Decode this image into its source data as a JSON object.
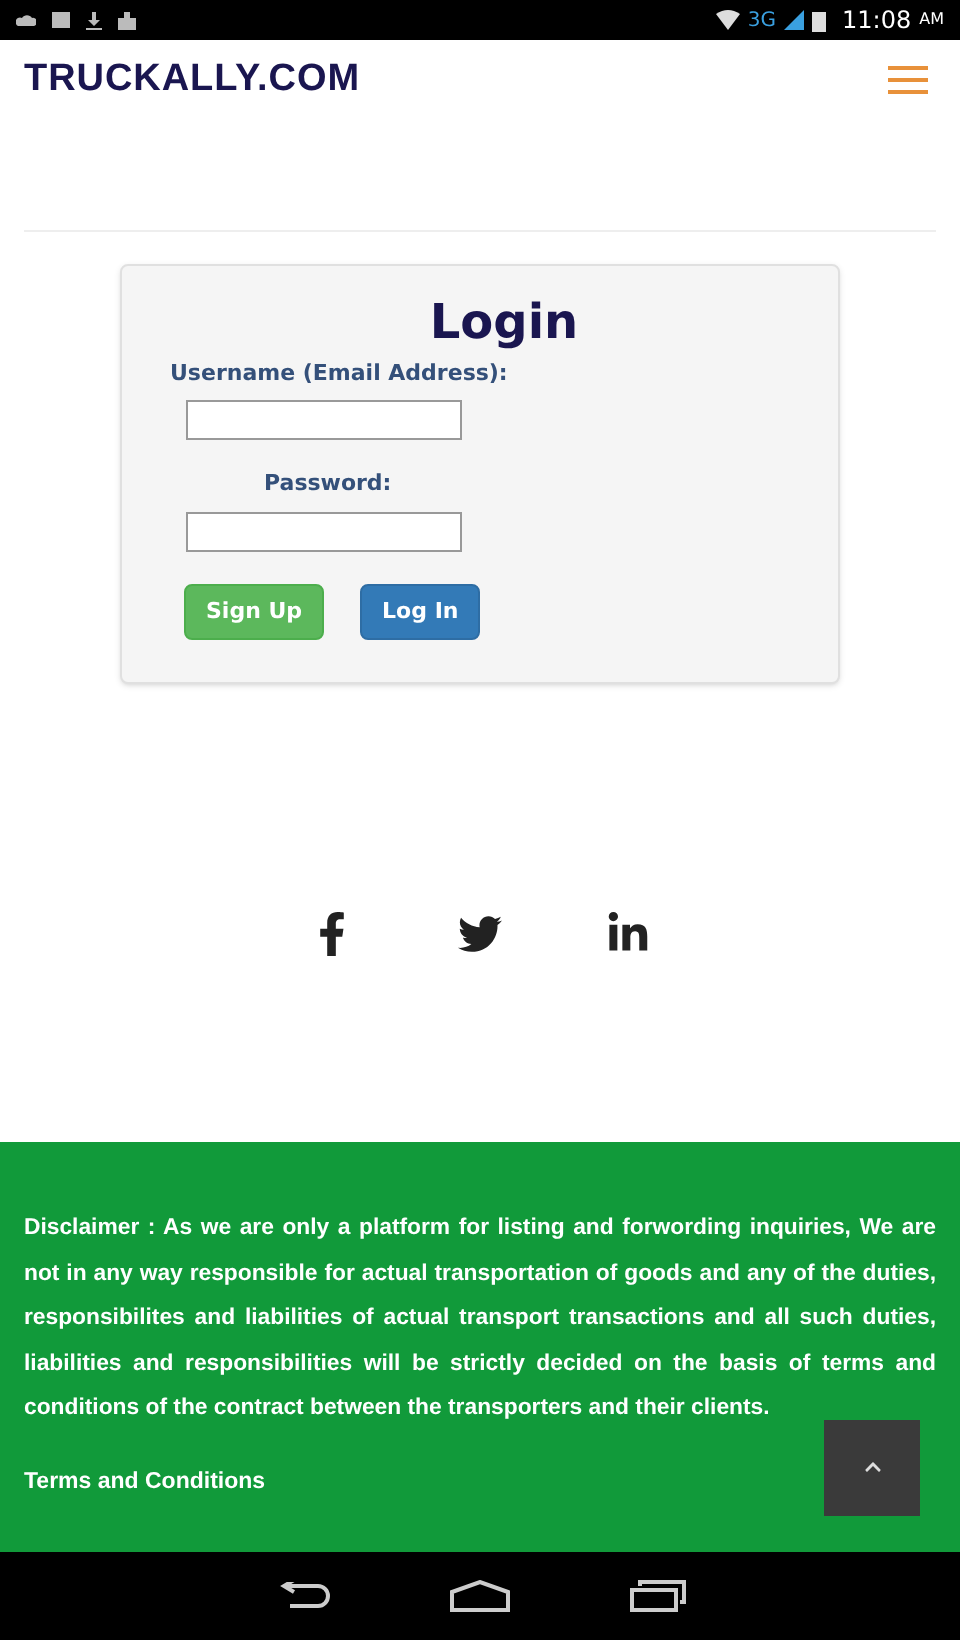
{
  "status_bar": {
    "network": "3G",
    "time": "11:08",
    "meridiem": "AM"
  },
  "header": {
    "logo": "TRUCKALLY.COM"
  },
  "login": {
    "title": "Login",
    "username_label": "Username (Email Address):",
    "password_label": "Password:",
    "buttons": [
      {
        "label": "Sign Up",
        "kind": "success"
      },
      {
        "label": "Log In",
        "kind": "primary"
      }
    ]
  },
  "social": [
    {
      "kind": "facebook"
    },
    {
      "kind": "twitter"
    },
    {
      "kind": "linkedin"
    }
  ],
  "footer": {
    "disclaimer": "Disclaimer : As we are only a platform for listing and forwording inquiries, We are not in any way responsible for actual transportation of goods and any of the duties, responsibilites and liabilities of actual transport transactions and all such duties, liabilities and responsibilities will be strictly decided on the basis of terms and conditions of the contract between the transporters and their clients.",
    "link": "Terms and Conditions"
  }
}
